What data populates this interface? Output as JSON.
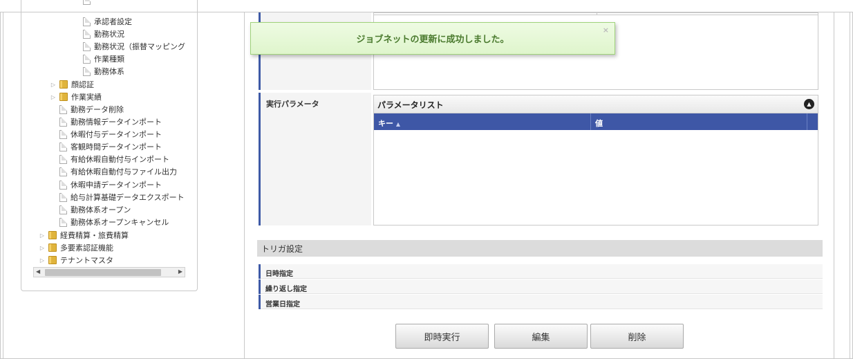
{
  "tree": {
    "items": [
      {
        "label": "承認者設定",
        "kind": "doc"
      },
      {
        "label": "勤務状況",
        "kind": "doc"
      },
      {
        "label": "勤務状況（振替マッピング",
        "kind": "doc"
      },
      {
        "label": "作業種類",
        "kind": "doc"
      },
      {
        "label": "勤務体系",
        "kind": "doc"
      },
      {
        "label": "顔認証",
        "kind": "folder"
      },
      {
        "label": "作業実績",
        "kind": "folder"
      },
      {
        "label": "勤務データ削除",
        "kind": "doc"
      },
      {
        "label": "勤務情報データインポート",
        "kind": "doc"
      },
      {
        "label": "休暇付与データインポート",
        "kind": "doc"
      },
      {
        "label": "客観時間データインポート",
        "kind": "doc"
      },
      {
        "label": "有給休暇自動付与インポート",
        "kind": "doc"
      },
      {
        "label": "有給休暇自動付与ファイル出力",
        "kind": "doc"
      },
      {
        "label": "休暇申請データインポート",
        "kind": "doc"
      },
      {
        "label": "給与計算基礎データエクスポート",
        "kind": "doc"
      },
      {
        "label": "勤務体系オープン",
        "kind": "doc"
      },
      {
        "label": "勤務体系オープンキャンセル",
        "kind": "doc"
      },
      {
        "label": "経費精算・旅費精算",
        "kind": "folder"
      },
      {
        "label": "多要素認証機能",
        "kind": "folder"
      },
      {
        "label": "テナントマスタ",
        "kind": "folder"
      }
    ]
  },
  "toast": {
    "message": "ジョブネットの更新に成功しました。",
    "close": "×"
  },
  "params": {
    "label": "実行パラメータ",
    "list_title": "パラメータリスト",
    "col_key": "キー",
    "col_value": "値"
  },
  "trigger": {
    "title": "トリガ設定",
    "rows": [
      "日時指定",
      "繰り返し指定",
      "営業日指定"
    ]
  },
  "buttons": {
    "run": "即時実行",
    "edit": "編集",
    "delete": "削除"
  }
}
